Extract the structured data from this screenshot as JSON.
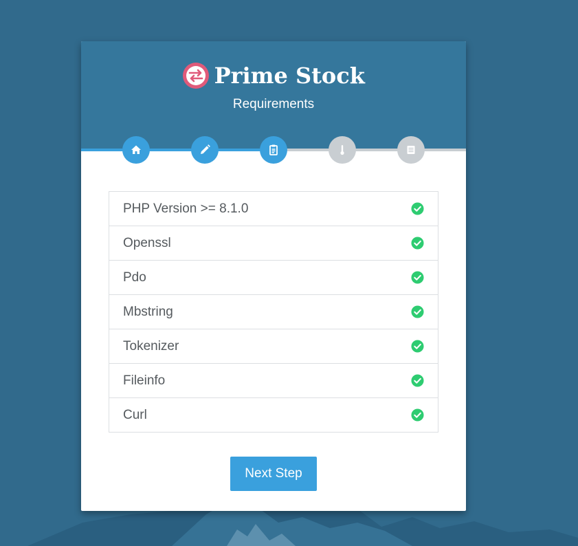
{
  "app": {
    "brand_name": "Prime Stock",
    "logo_icon": "swap-arrows-logo-icon"
  },
  "header": {
    "subtitle": "Requirements"
  },
  "colors": {
    "background": "#316a8c",
    "header": "#35779c",
    "accent": "#3aa0dd",
    "step_inactive": "#c9ced2",
    "check": "#2ecc71",
    "logo": "#e05a7a"
  },
  "steps": [
    {
      "icon": "home-icon",
      "state": "active"
    },
    {
      "icon": "pencil-icon",
      "state": "active"
    },
    {
      "icon": "clipboard-icon",
      "state": "active"
    },
    {
      "icon": "thermometer-icon",
      "state": "inactive"
    },
    {
      "icon": "list-icon",
      "state": "inactive"
    }
  ],
  "progress": {
    "completed_steps": 3,
    "total_steps": 5
  },
  "requirements": [
    {
      "label": "PHP Version >= 8.1.0",
      "status": "check-circle-icon"
    },
    {
      "label": "Openssl",
      "status": "check-circle-icon"
    },
    {
      "label": "Pdo",
      "status": "check-circle-icon"
    },
    {
      "label": "Mbstring",
      "status": "check-circle-icon"
    },
    {
      "label": "Tokenizer",
      "status": "check-circle-icon"
    },
    {
      "label": "Fileinfo",
      "status": "check-circle-icon"
    },
    {
      "label": "Curl",
      "status": "check-circle-icon"
    }
  ],
  "actions": {
    "next_label": "Next Step"
  }
}
